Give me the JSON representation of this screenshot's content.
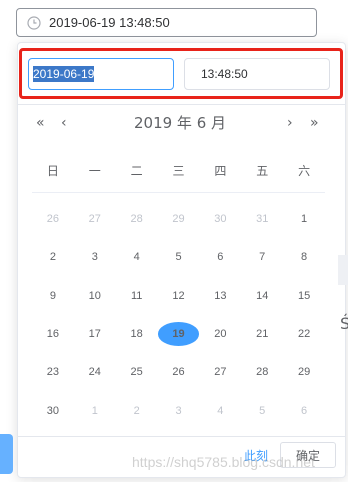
{
  "trigger": {
    "value": "2019-06-19 13:48:50",
    "icon": "clock-icon"
  },
  "panel": {
    "date_value": "2019-06-19",
    "time_value": "13:48:50",
    "header": {
      "title": "2019 年  6 月",
      "prev_year": "«",
      "prev_month": "‹",
      "next_month": "›",
      "next_year": "»"
    },
    "weekdays": [
      "日",
      "一",
      "二",
      "三",
      "四",
      "五",
      "六"
    ],
    "weeks": [
      [
        {
          "d": "26",
          "o": true
        },
        {
          "d": "27",
          "o": true
        },
        {
          "d": "28",
          "o": true
        },
        {
          "d": "29",
          "o": true
        },
        {
          "d": "30",
          "o": true
        },
        {
          "d": "31",
          "o": true
        },
        {
          "d": "1",
          "o": false
        }
      ],
      [
        {
          "d": "2",
          "o": false
        },
        {
          "d": "3",
          "o": false
        },
        {
          "d": "4",
          "o": false
        },
        {
          "d": "5",
          "o": false
        },
        {
          "d": "6",
          "o": false
        },
        {
          "d": "7",
          "o": false
        },
        {
          "d": "8",
          "o": false
        }
      ],
      [
        {
          "d": "9",
          "o": false
        },
        {
          "d": "10",
          "o": false
        },
        {
          "d": "11",
          "o": false
        },
        {
          "d": "12",
          "o": false
        },
        {
          "d": "13",
          "o": false
        },
        {
          "d": "14",
          "o": false
        },
        {
          "d": "15",
          "o": false
        }
      ],
      [
        {
          "d": "16",
          "o": false
        },
        {
          "d": "17",
          "o": false
        },
        {
          "d": "18",
          "o": false
        },
        {
          "d": "19",
          "o": false,
          "today": true
        },
        {
          "d": "20",
          "o": false
        },
        {
          "d": "21",
          "o": false
        },
        {
          "d": "22",
          "o": false
        }
      ],
      [
        {
          "d": "23",
          "o": false
        },
        {
          "d": "24",
          "o": false
        },
        {
          "d": "25",
          "o": false
        },
        {
          "d": "26",
          "o": false
        },
        {
          "d": "27",
          "o": false
        },
        {
          "d": "28",
          "o": false
        },
        {
          "d": "29",
          "o": false
        }
      ],
      [
        {
          "d": "30",
          "o": false
        },
        {
          "d": "1",
          "o": true
        },
        {
          "d": "2",
          "o": true
        },
        {
          "d": "3",
          "o": true
        },
        {
          "d": "4",
          "o": true
        },
        {
          "d": "5",
          "o": true
        },
        {
          "d": "6",
          "o": true
        }
      ]
    ],
    "footer": {
      "now_label": "此刻",
      "confirm_label": "确定"
    }
  },
  "side_char": "Ś",
  "watermark": "https://shq5785.blog.csdn.net",
  "colors": {
    "accent": "#409eff",
    "highlight": "#e8231a"
  }
}
